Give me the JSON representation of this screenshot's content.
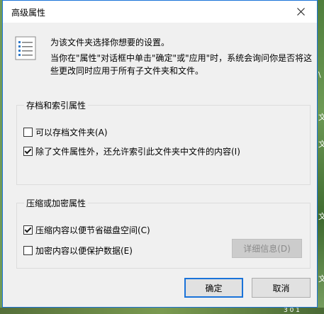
{
  "background": {
    "right_snippets": [
      "文",
      "文",
      "文",
      "文",
      "\\"
    ],
    "bottom_snippet": "3 0 1"
  },
  "dialog": {
    "title": "高级属性",
    "accent_color": "#1a73d9",
    "close_icon": "close-icon",
    "info": {
      "icon": "document-list-icon",
      "line1": "为该文件夹选择你想要的设置。",
      "line2": "当你在\"属性\"对话框中单击\"确定\"或\"应用\"时，系统会询问你是否将这",
      "line3": "些更改同时应用于所有子文件夹和文件。"
    },
    "archive_group": {
      "legend": "存档和索引属性",
      "items": [
        {
          "label": "可以存档文件夹(A)",
          "checked": false
        },
        {
          "label": "除了文件属性外，还允许索引此文件夹中文件的内容(I)",
          "checked": true
        }
      ]
    },
    "compress_group": {
      "legend": "压缩或加密属性",
      "items": [
        {
          "label": "压缩内容以便节省磁盘空间(C)",
          "checked": true
        },
        {
          "label": "加密内容以便保护数据(E)",
          "checked": false
        }
      ],
      "details_button": "详细信息(D)"
    },
    "ok_button": "确定",
    "cancel_button": "取消"
  }
}
